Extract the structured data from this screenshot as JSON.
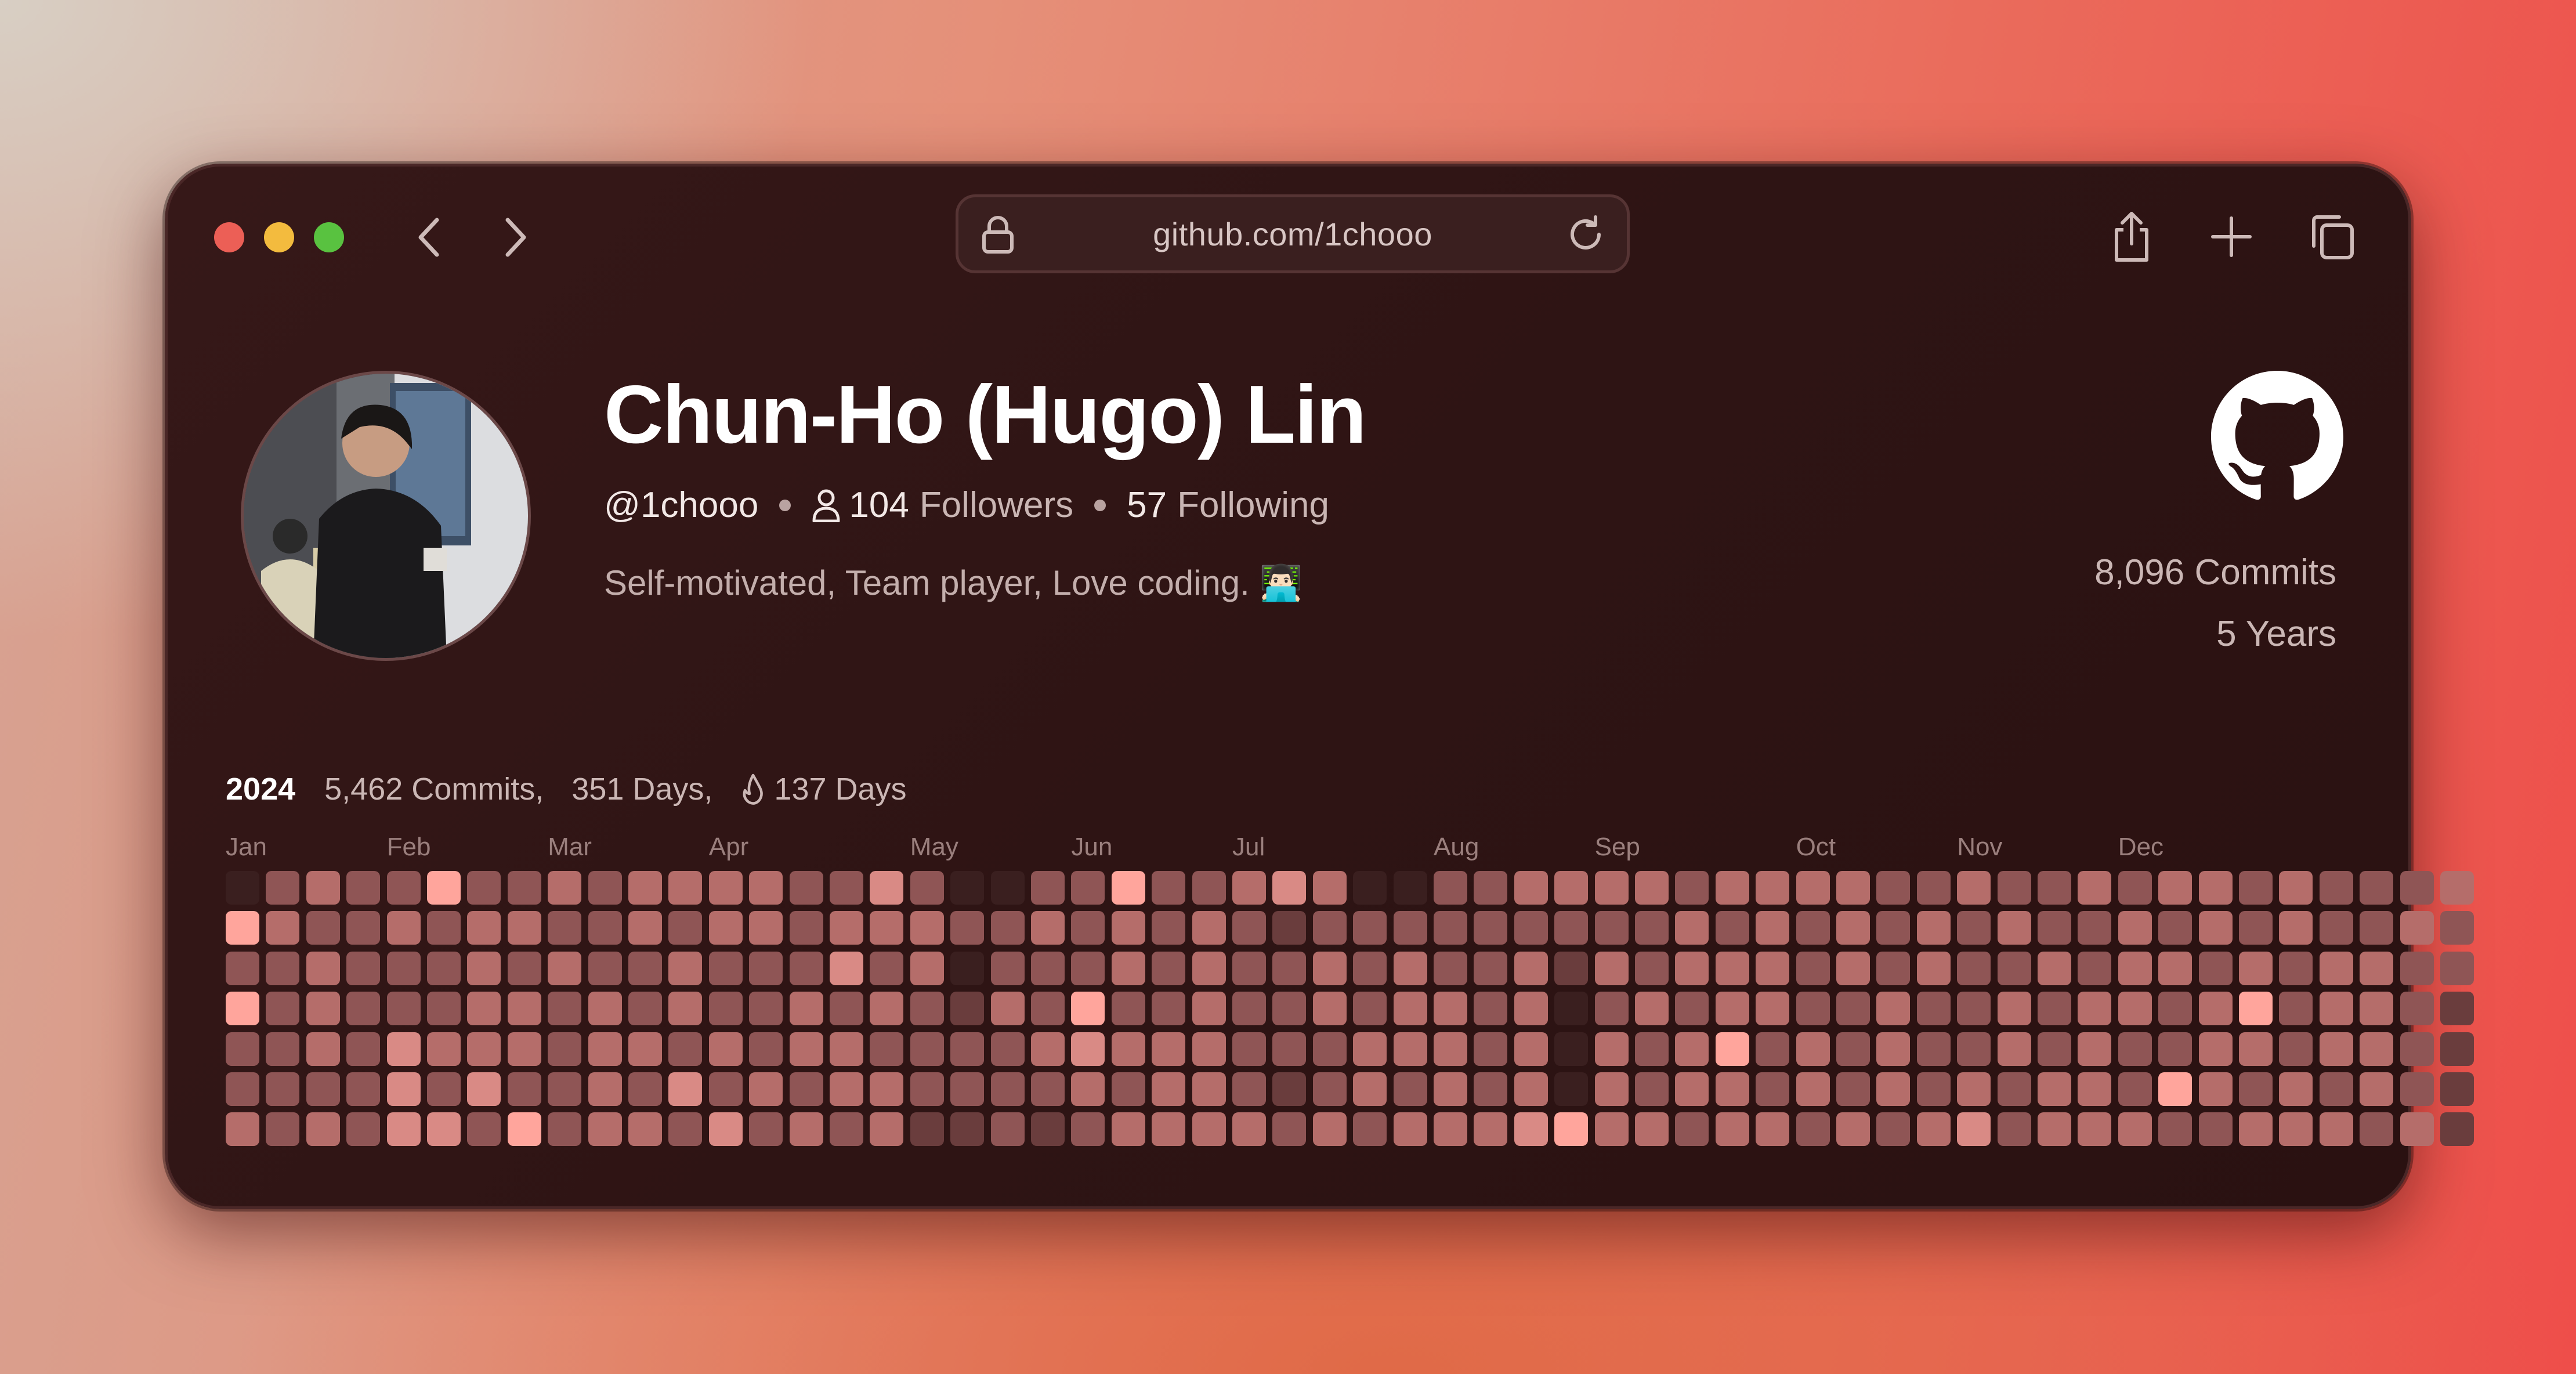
{
  "window": {
    "url": "github.com/1chooo"
  },
  "profile": {
    "name": "Chun-Ho (Hugo) Lin",
    "handle": "@1chooo",
    "followers_count": "104",
    "followers_label": "Followers",
    "following_count": "57",
    "following_label": "Following",
    "bio": "Self-motivated, Team player, Love coding. 👨🏻‍💻",
    "total_commits": "8,096 Commits",
    "total_years": "5 Years"
  },
  "icons": {
    "back": "chevron-left-icon",
    "forward": "chevron-right-icon",
    "lock": "lock-icon",
    "reload": "reload-icon",
    "share": "share-icon",
    "new_tab": "plus-icon",
    "tabs": "tabs-overview-icon",
    "github": "github-logo-icon",
    "followers": "person-icon",
    "streak": "flame-icon"
  },
  "activity": {
    "year": "2024",
    "commits": "5,462 Commits,",
    "days": "351 Days,",
    "streak": "137 Days",
    "months": [
      "Jan",
      "Feb",
      "Mar",
      "Apr",
      "May",
      "Jun",
      "Jul",
      "Aug",
      "Sep",
      "Oct",
      "Nov",
      "Dec"
    ],
    "palette": [
      "#3a1f1f",
      "#6a3d3d",
      "#8f5555",
      "#b56d6a",
      "#d98a85",
      "#ffa59c"
    ],
    "levels": [
      [
        0,
        2,
        3,
        2,
        2,
        5,
        2,
        2,
        3,
        2,
        3,
        3,
        3,
        3,
        2,
        2,
        4,
        2,
        0,
        0,
        2,
        2,
        5,
        2,
        2,
        3,
        4,
        3,
        0,
        0,
        2,
        2,
        3,
        3,
        3,
        3,
        2,
        3,
        3,
        3,
        3,
        2,
        2,
        3,
        2,
        2,
        3,
        2,
        3,
        3,
        2,
        3,
        2,
        2,
        2,
        3
      ],
      [
        5,
        3,
        2,
        2,
        3,
        2,
        3,
        3,
        2,
        2,
        3,
        2,
        3,
        3,
        2,
        3,
        3,
        3,
        2,
        2,
        3,
        2,
        3,
        2,
        3,
        2,
        1,
        2,
        2,
        2,
        2,
        2,
        2,
        2,
        2,
        2,
        3,
        2,
        3,
        2,
        3,
        2,
        3,
        2,
        3,
        2,
        2,
        3,
        2,
        3,
        2,
        3,
        2,
        2,
        3,
        2
      ],
      [
        2,
        2,
        3,
        2,
        2,
        2,
        3,
        2,
        3,
        2,
        2,
        3,
        2,
        2,
        2,
        4,
        2,
        3,
        0,
        2,
        2,
        2,
        3,
        2,
        3,
        2,
        2,
        3,
        2,
        3,
        2,
        2,
        3,
        1,
        3,
        2,
        3,
        3,
        3,
        2,
        3,
        2,
        3,
        2,
        2,
        3,
        2,
        3,
        3,
        2,
        3,
        2,
        3,
        3,
        2,
        2
      ],
      [
        5,
        2,
        3,
        2,
        2,
        2,
        3,
        3,
        2,
        3,
        2,
        3,
        2,
        2,
        3,
        2,
        3,
        2,
        1,
        3,
        2,
        5,
        2,
        2,
        3,
        2,
        2,
        3,
        2,
        3,
        3,
        2,
        3,
        0,
        2,
        3,
        2,
        3,
        3,
        2,
        2,
        3,
        2,
        2,
        3,
        2,
        3,
        3,
        2,
        3,
        5,
        2,
        3,
        3,
        2,
        1
      ],
      [
        2,
        2,
        3,
        2,
        4,
        3,
        3,
        3,
        2,
        3,
        3,
        2,
        3,
        2,
        3,
        3,
        2,
        2,
        2,
        2,
        3,
        4,
        3,
        3,
        3,
        2,
        2,
        2,
        3,
        3,
        3,
        2,
        3,
        0,
        3,
        2,
        3,
        5,
        2,
        3,
        2,
        3,
        2,
        2,
        3,
        2,
        3,
        2,
        2,
        3,
        3,
        2,
        3,
        3,
        2,
        1
      ],
      [
        2,
        2,
        2,
        2,
        4,
        2,
        4,
        2,
        2,
        3,
        2,
        4,
        2,
        3,
        2,
        3,
        3,
        2,
        2,
        2,
        2,
        3,
        2,
        3,
        3,
        2,
        1,
        2,
        3,
        2,
        3,
        2,
        3,
        0,
        3,
        2,
        3,
        3,
        2,
        3,
        2,
        3,
        2,
        3,
        2,
        3,
        3,
        2,
        5,
        3,
        2,
        3,
        2,
        3,
        2,
        1
      ],
      [
        3,
        2,
        3,
        2,
        4,
        4,
        2,
        5,
        2,
        3,
        3,
        2,
        4,
        2,
        3,
        2,
        3,
        1,
        1,
        2,
        1,
        2,
        3,
        3,
        3,
        3,
        2,
        3,
        2,
        3,
        3,
        3,
        4,
        5,
        3,
        3,
        2,
        3,
        3,
        2,
        3,
        2,
        3,
        4,
        2,
        3,
        3,
        3,
        2,
        2,
        3,
        3,
        3,
        2,
        3,
        1
      ]
    ]
  }
}
